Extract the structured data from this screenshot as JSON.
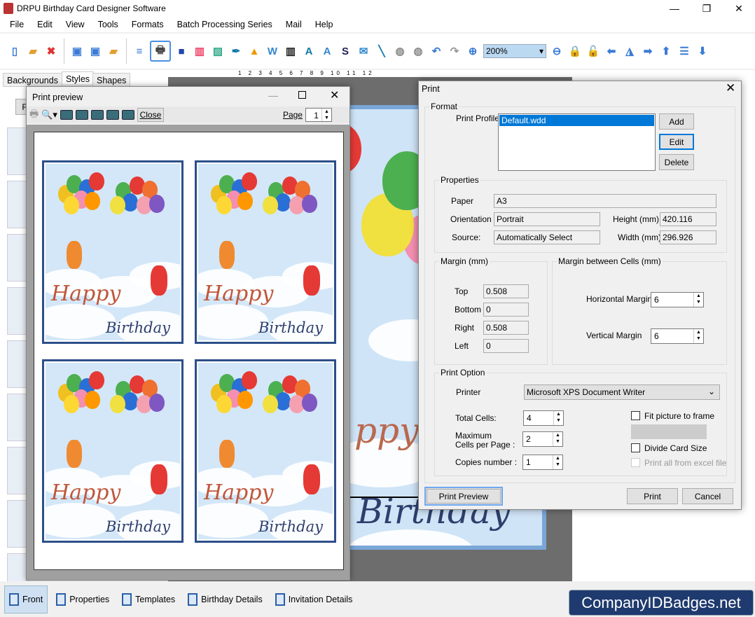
{
  "app": {
    "title": "DRPU Birthday Card Designer Software",
    "window_controls": [
      "—",
      "❐",
      "✕"
    ]
  },
  "menu": [
    "File",
    "Edit",
    "View",
    "Tools",
    "Formats",
    "Batch Processing Series",
    "Mail",
    "Help"
  ],
  "toolbar": {
    "icons": [
      "new-icon",
      "open-icon",
      "close-file-icon",
      "save-icon",
      "save-as-icon",
      "export-icon",
      "page-setup-icon",
      "print-icon",
      "background-icon",
      "gift-icon",
      "add-image-icon",
      "pen-icon",
      "shapes-icon",
      "wordart-icon",
      "barcode-icon",
      "text-icon",
      "text-frame-icon",
      "signature-icon",
      "mail-icon",
      "line-icon",
      "database-icon",
      "database2-icon",
      "undo-icon",
      "redo-icon",
      "zoom-in-icon",
      "zoom-out-icon",
      "lock-icon",
      "unlock-icon",
      "arrow-left-icon",
      "flip-icon",
      "arrow-right-icon",
      "arrow-up-icon",
      "align-icon",
      "arrow-down-icon"
    ],
    "zoom": "200%"
  },
  "left_tabs": [
    "Backgrounds",
    "Styles",
    "Shapes"
  ],
  "left_front_btn": "Fr",
  "ruler": "1 2 3 4 5 6 7 8 9 10 11 12",
  "preview": {
    "title": "Print preview",
    "close": "Close",
    "page_label": "Page",
    "page": "1"
  },
  "cards": {
    "happy": "Happy",
    "birthday": "Birthday"
  },
  "canvas_text": {
    "happy": "ppy",
    "birthday": "Birthday"
  },
  "dialog": {
    "title": "Print",
    "format": {
      "legend": "Format",
      "profile_label": "Print Profile",
      "profile_selected": "Default.wdd",
      "add": "Add",
      "edit": "Edit",
      "delete": "Delete"
    },
    "properties": {
      "legend": "Properties",
      "paper_label": "Paper",
      "paper": "A3",
      "orientation_label": "Orientation",
      "orientation": "Portrait",
      "source_label": "Source:",
      "source": "Automatically Select",
      "height_label": "Height (mm)",
      "height": "420.116",
      "width_label": "Width (mm)",
      "width": "296.926"
    },
    "margin": {
      "legend": "Margin (mm)",
      "top_label": "Top",
      "top": "0.508",
      "bottom_label": "Bottom",
      "bottom": "0",
      "right_label": "Right",
      "right": "0.508",
      "left_label": "Left",
      "left": "0"
    },
    "cell_margin": {
      "legend": "Margin between Cells (mm)",
      "h_label": "Horizontal Margin",
      "h": "6",
      "v_label": "Vertical Margin",
      "v": "6"
    },
    "print_option": {
      "legend": "Print Option",
      "printer_label": "Printer",
      "printer": "Microsoft XPS Document Writer",
      "total_label": "Total Cells:",
      "total": "4",
      "max_label1": "Maximum",
      "max_label2": "Cells per Page :",
      "max": "2",
      "copies_label": "Copies number :",
      "copies": "1",
      "fit_label": "Fit picture to frame",
      "fit": false,
      "divide_label": "Divide Card Size",
      "divide": false,
      "excel_label": "Print all from excel file",
      "excel": false
    },
    "preview_btn": "Print Preview",
    "print_btn": "Print",
    "cancel_btn": "Cancel"
  },
  "bottom_tabs": [
    "Front",
    "Properties",
    "Templates",
    "Birthday Details",
    "Invitation Details"
  ],
  "watermark": "CompanyIDBadges.net"
}
